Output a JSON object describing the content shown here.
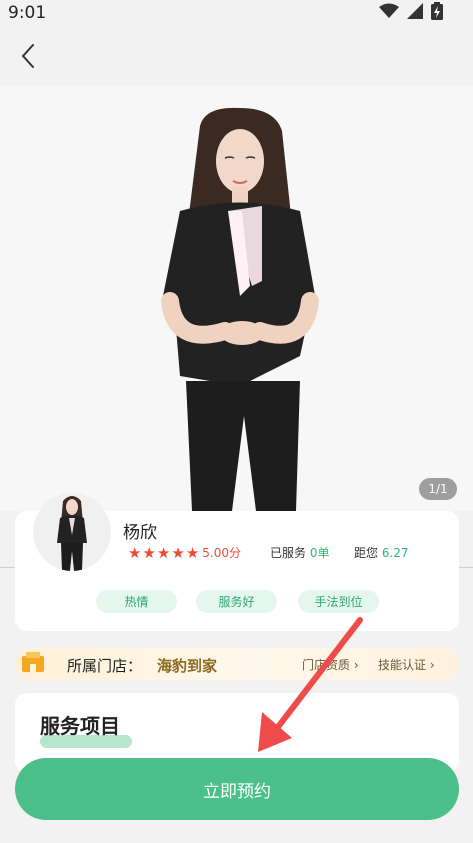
{
  "status_bar": {
    "time": "9:01"
  },
  "gallery": {
    "indicator": "1/1"
  },
  "profile": {
    "name": "杨欣",
    "rating": "5.00分",
    "served_label": "已服务",
    "served_count": "0单",
    "distance_label": "距您",
    "distance_value": "6.27",
    "tags": [
      "热情",
      "服务好",
      "手法到位"
    ]
  },
  "store": {
    "label": "所属门店：",
    "name": "海豹到家",
    "qualification_link": "门店资质",
    "skill_link": "技能认证"
  },
  "services": {
    "title": "服务项目"
  },
  "actions": {
    "book_label": "立即预约"
  },
  "colors": {
    "accent": "#4bc08a",
    "star": "#ef4b33",
    "store_name": "#8a6b20",
    "arrow": "#ef4b4b"
  }
}
